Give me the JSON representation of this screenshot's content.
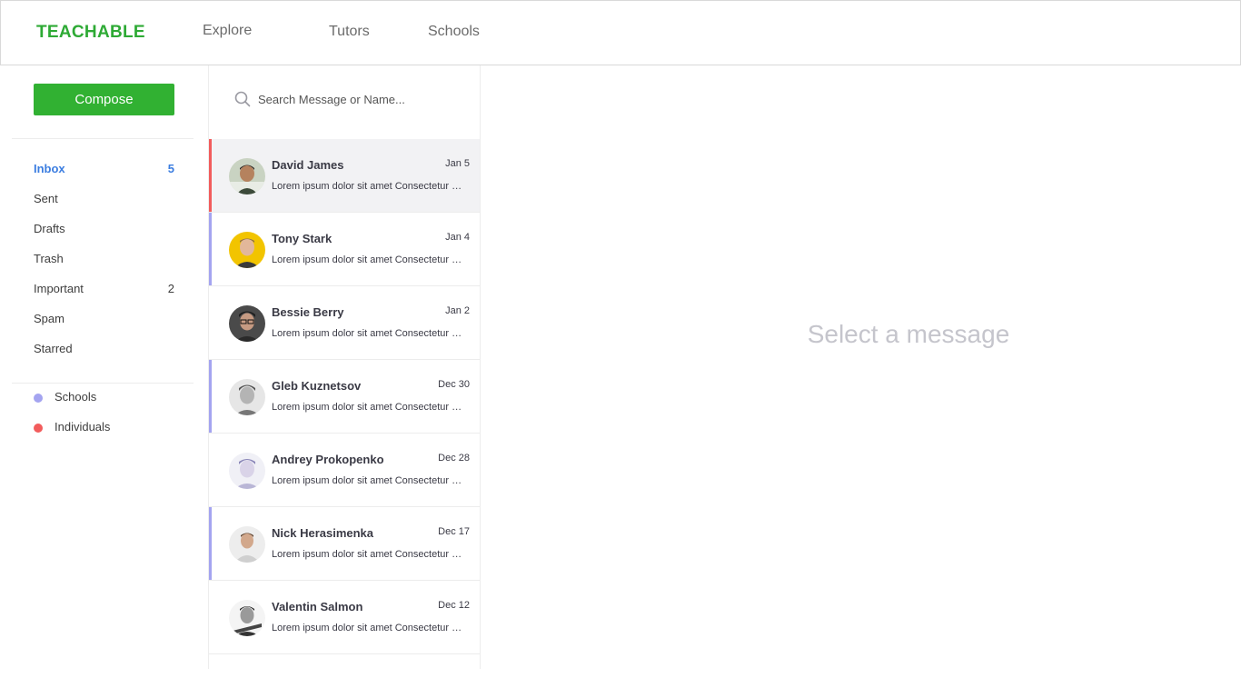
{
  "header": {
    "logo": "TEACHABLE",
    "nav": [
      "Explore",
      "Tutors",
      "Schools"
    ]
  },
  "sidebar": {
    "compose_label": "Compose",
    "folders": [
      {
        "label": "Inbox",
        "count": "5"
      },
      {
        "label": "Sent",
        "count": ""
      },
      {
        "label": "Drafts",
        "count": ""
      },
      {
        "label": "Trash",
        "count": ""
      },
      {
        "label": "Important",
        "count": "2"
      },
      {
        "label": "Spam",
        "count": ""
      },
      {
        "label": "Starred",
        "count": ""
      }
    ],
    "labels": [
      {
        "label": "Schools",
        "color": "#a4a4f0"
      },
      {
        "label": "Individuals",
        "color": "#f25c5c"
      }
    ]
  },
  "search": {
    "placeholder": "Search Message or Name..."
  },
  "messages": [
    {
      "name": "David James",
      "date": "Jan 5",
      "preview": "Lorem ipsum dolor sit amet Consectetur adipiscing",
      "bar": "#f25c5c"
    },
    {
      "name": "Tony Stark",
      "date": "Jan 4",
      "preview": "Lorem ipsum dolor sit amet Consectetur adipiscing",
      "bar": "#a4a4f0"
    },
    {
      "name": "Bessie Berry",
      "date": "Jan 2",
      "preview": "Lorem ipsum dolor sit amet Consectetur adipiscing",
      "bar": ""
    },
    {
      "name": "Gleb Kuznetsov",
      "date": "Dec 30",
      "preview": "Lorem ipsum dolor sit amet Consectetur adipiscing",
      "bar": "#a4a4f0"
    },
    {
      "name": "Andrey Prokopenko",
      "date": "Dec 28",
      "preview": "Lorem ipsum dolor sit amet Consectetur adipiscing",
      "bar": ""
    },
    {
      "name": "Nick Herasimenka",
      "date": "Dec 17",
      "preview": "Lorem ipsum dolor sit amet Consectetur adipiscing",
      "bar": "#a4a4f0"
    },
    {
      "name": "Valentin Salmon",
      "date": "Dec 12",
      "preview": "Lorem ipsum dolor sit amet Consectetur adipiscing",
      "bar": ""
    }
  ],
  "empty_state": "Select a message",
  "colors": {
    "brand": "#2eaa35",
    "compose_bg": "#31b132",
    "active_folder": "#3b7de0",
    "selected_row": "#f2f2f4"
  }
}
